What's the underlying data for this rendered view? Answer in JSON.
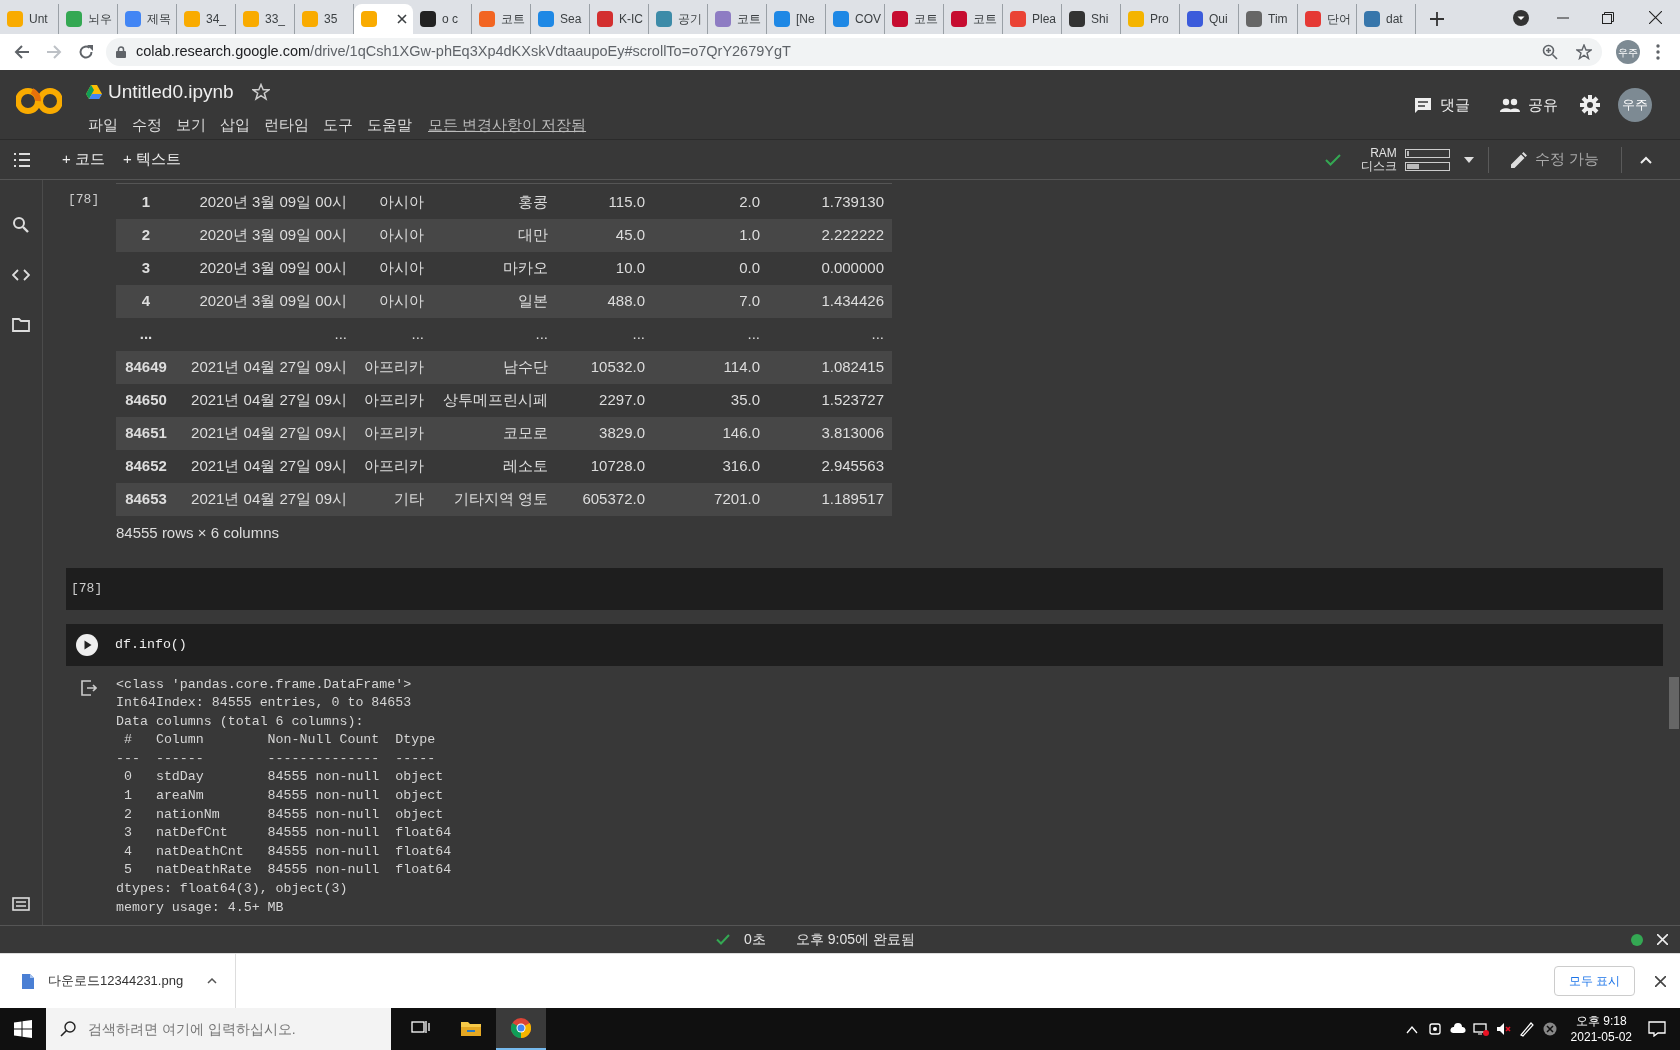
{
  "browser": {
    "tabs": [
      {
        "label": "Unt",
        "color": "#f9ab00",
        "selected": false
      },
      {
        "label": "뇌우",
        "color": "#34a853",
        "selected": false
      },
      {
        "label": "제목",
        "color": "#4285f4",
        "selected": false
      },
      {
        "label": "34_",
        "color": "#f9ab00",
        "selected": false
      },
      {
        "label": "33_",
        "color": "#f9ab00",
        "selected": false
      },
      {
        "label": "35",
        "color": "#f9ab00",
        "selected": false
      },
      {
        "color": "#f9ab00",
        "selected": true
      },
      {
        "label": "o c",
        "color": "#222222",
        "selected": false
      },
      {
        "label": "코트",
        "color": "#f26522",
        "selected": false
      },
      {
        "label": "Sea",
        "color": "#1e88e5",
        "selected": false
      },
      {
        "label": "K-IC",
        "color": "#d32f2f",
        "selected": false
      },
      {
        "label": "공기",
        "color": "#3d8ba8",
        "selected": false
      },
      {
        "label": "코트",
        "color": "#8e7cc3",
        "selected": false
      },
      {
        "label": "[Ne",
        "color": "#1e88e5",
        "selected": false
      },
      {
        "label": "COV",
        "color": "#1e88e5",
        "selected": false
      },
      {
        "label": "코트",
        "color": "#c60c30",
        "selected": false
      },
      {
        "label": "코트",
        "color": "#c60c30",
        "selected": false
      },
      {
        "label": "Plea",
        "color": "#ea4335",
        "selected": false
      },
      {
        "label": "Shi",
        "color": "#333333",
        "selected": false
      },
      {
        "label": "Pro",
        "color": "#f4b400",
        "selected": false
      },
      {
        "label": "Qui",
        "color": "#3b5bdb",
        "selected": false
      },
      {
        "label": "Tim",
        "color": "#666666",
        "selected": false
      },
      {
        "label": "단어",
        "color": "#e53935",
        "selected": false
      },
      {
        "label": "dat",
        "color": "#3776ab",
        "selected": false
      }
    ],
    "url_host": "colab.research.google.com",
    "url_path": "/drive/1qCsh1XGw-phEq3Xp4dKXskVdtaaupoEy#scrollTo=o7QrY2679YgT",
    "profile": "우주"
  },
  "notebook": {
    "title": "Untitled0.ipynb",
    "menu": [
      "파일",
      "수정",
      "보기",
      "삽입",
      "런타임",
      "도구",
      "도움말"
    ],
    "save_status": "모든 변경사항이 저장됨",
    "actions": [
      "댓글",
      "공유"
    ],
    "avatar": "우주"
  },
  "toolbar": {
    "insert": [
      "+ 코드",
      "+ 텍스트"
    ],
    "resources": [
      {
        "label": "RAM",
        "level": 0.05
      },
      {
        "label": "디스크",
        "level": 0.3
      }
    ],
    "edit_mode": "수정 가능"
  },
  "cells": [
    {
      "kind": "table_output",
      "prompt": "[78]",
      "rows": [
        {
          "index": "1",
          "cells": [
            "2020년 3월 09일 00시",
            "아시아",
            "홍콩",
            "115.0",
            "2.0",
            "1.739130"
          ]
        },
        {
          "index": "2",
          "cells": [
            "2020년 3월 09일 00시",
            "아시아",
            "대만",
            "45.0",
            "1.0",
            "2.222222"
          ]
        },
        {
          "index": "3",
          "cells": [
            "2020년 3월 09일 00시",
            "아시아",
            "마카오",
            "10.0",
            "0.0",
            "0.000000"
          ]
        },
        {
          "index": "4",
          "cells": [
            "2020년 3월 09일 00시",
            "아시아",
            "일본",
            "488.0",
            "7.0",
            "1.434426"
          ]
        },
        {
          "index": "...",
          "cells": [
            "...",
            "...",
            "...",
            "...",
            "...",
            "..."
          ]
        },
        {
          "index": "84649",
          "cells": [
            "2021년 04월 27일 09시",
            "아프리카",
            "남수단",
            "10532.0",
            "114.0",
            "1.082415"
          ]
        },
        {
          "index": "84650",
          "cells": [
            "2021년 04월 27일 09시",
            "아프리카",
            "상투메프린시페",
            "2297.0",
            "35.0",
            "1.523727"
          ]
        },
        {
          "index": "84651",
          "cells": [
            "2021년 04월 27일 09시",
            "아프리카",
            "코모로",
            "3829.0",
            "146.0",
            "3.813006"
          ]
        },
        {
          "index": "84652",
          "cells": [
            "2021년 04월 27일 09시",
            "아프리카",
            "레소토",
            "10728.0",
            "316.0",
            "2.945563"
          ]
        },
        {
          "index": "84653",
          "cells": [
            "2021년 04월 27일 09시",
            "기타",
            "기타지역 영토",
            "605372.0",
            "7201.0",
            "1.189517"
          ]
        }
      ],
      "caption": "84555 rows × 6 columns"
    },
    {
      "kind": "code",
      "prompt": "[78]"
    },
    {
      "kind": "code",
      "code": "df.info()",
      "output": [
        "<class 'pandas.core.frame.DataFrame'>",
        "Int64Index: 84555 entries, 0 to 84653",
        "Data columns (total 6 columns):",
        " #   Column        Non-Null Count  Dtype",
        "---  ------        --------------  -----",
        " 0   stdDay        84555 non-null  object",
        " 1   areaNm        84555 non-null  object",
        " 2   nationNm      84555 non-null  object",
        " 3   natDefCnt     84555 non-null  float64",
        " 4   natDeathCnt   84555 non-null  float64",
        " 5   natDeathRate  84555 non-null  float64",
        "dtypes: float64(3), object(3)",
        "memory usage: 4.5+ MB"
      ]
    }
  ],
  "status_bar": {
    "duration": "0초",
    "message": "오후 9:05에 완료됨"
  },
  "downloads": {
    "file": "다운로드12344231.png",
    "show_all": "모두 표시"
  },
  "taskbar": {
    "search_placeholder": "검색하려면 여기에 입력하십시오.",
    "apps": [
      {
        "kind": "task-view",
        "selected": false
      },
      {
        "kind": "explorer",
        "selected": false
      },
      {
        "kind": "chrome",
        "selected": true
      }
    ],
    "time": "오후 9:18",
    "date": "2021-05-02"
  }
}
